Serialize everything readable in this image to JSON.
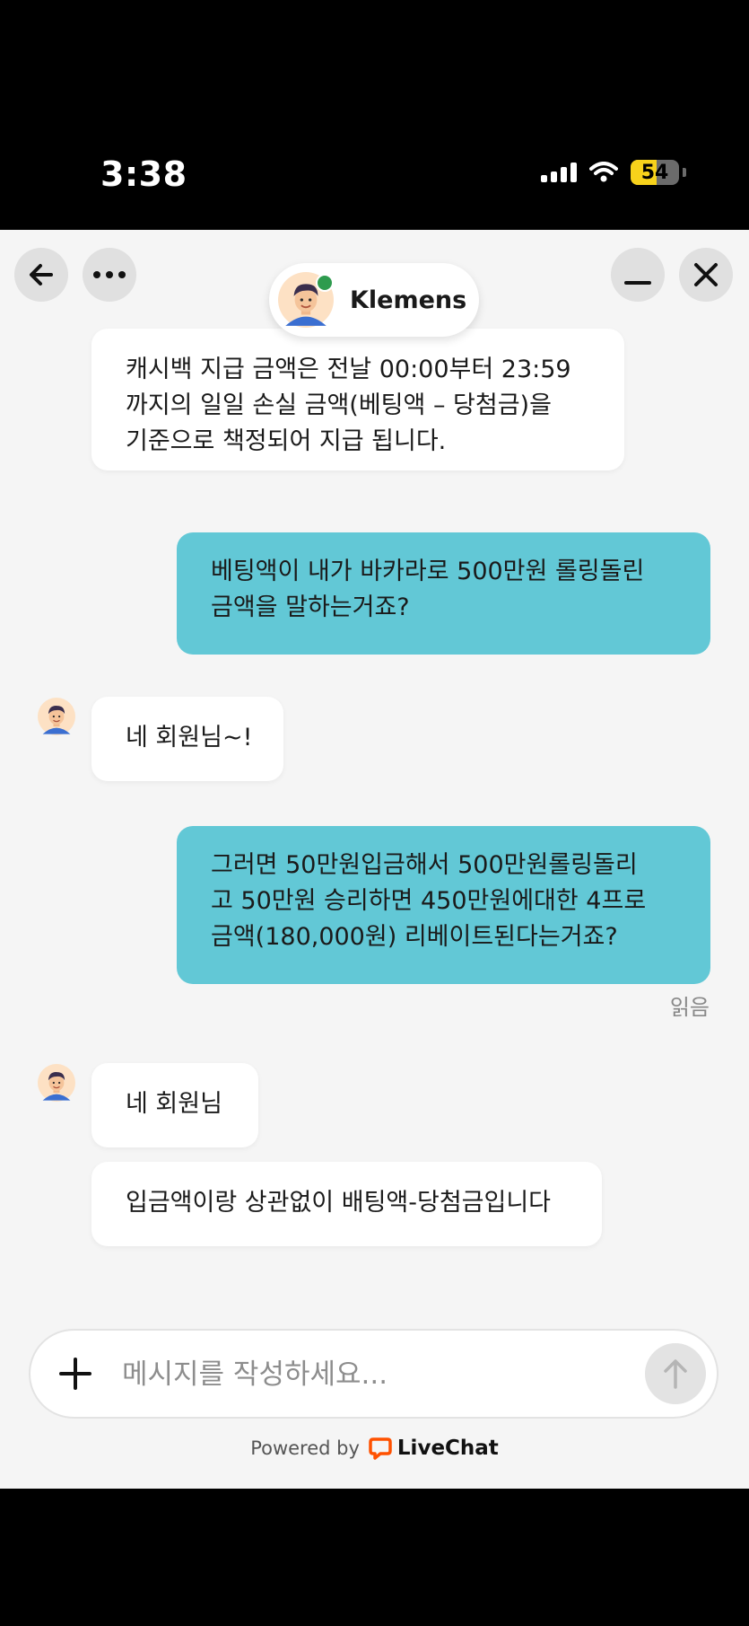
{
  "status_bar": {
    "time": "3:38",
    "battery": "54",
    "battery_level_pct": 54
  },
  "header": {
    "back_icon": "arrow-left-icon",
    "more_icon": "more-horizontal-icon",
    "minimize_icon": "minimize-icon",
    "close_icon": "close-icon",
    "agent_name": "Klemens",
    "online_color": "#2e9b4e"
  },
  "messages": {
    "m1": {
      "sender": "agent",
      "lines": [
        "캐시백 지급 금액은 전날 00:00부터 23:59",
        "까지의 일일 손실 금액(베팅액 – 당첨금)을",
        "기준으로 책정되어 지급 됩니다."
      ]
    },
    "m2": {
      "sender": "user",
      "lines": [
        "베팅액이 내가 바카라로 500만원 롤링돌린",
        "금액을 말하는거죠?"
      ]
    },
    "m3": {
      "sender": "agent",
      "lines": [
        "네 회원님~!"
      ]
    },
    "m4": {
      "sender": "user",
      "lines": [
        "그러면 50만원입금해서 500만원롤링돌리",
        "고 50만원 승리하면 450만원에대한 4프로",
        "금액(180,000원) 리베이트된다는거죠?"
      ]
    },
    "read_receipt": "읽음",
    "m5": {
      "sender": "agent",
      "lines": [
        "네 회원님"
      ]
    },
    "m6": {
      "sender": "agent",
      "lines": [
        "입금액이랑 상관없이 배팅액-당첨금입니다"
      ]
    }
  },
  "composer": {
    "placeholder": "메시지를 작성하세요...",
    "attach_icon": "plus-icon",
    "send_icon": "arrow-up-icon"
  },
  "footer": {
    "powered_by": "Powered by",
    "brand": "LiveChat",
    "brand_color": "#ff5100"
  },
  "colors": {
    "user_bubble": "#62c8d6",
    "agent_bubble": "#ffffff",
    "background": "#f5f5f5"
  }
}
